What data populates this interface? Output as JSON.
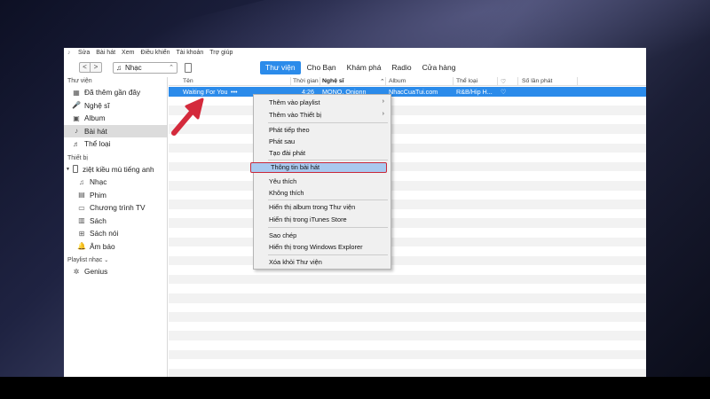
{
  "menubar": {
    "items": [
      "Sửa",
      "Bài hát",
      "Xem",
      "Điều khiển",
      "Tài khoản",
      "Trợ giúp"
    ]
  },
  "toolbar": {
    "back": "<",
    "forward": ">",
    "media_select": "Nhạc",
    "tabs": [
      "Thư viện",
      "Cho Bạn",
      "Khám phá",
      "Radio",
      "Cửa hàng"
    ],
    "active_tab": "Thư viện"
  },
  "sidebar": {
    "library_header": "Thư viện",
    "library_items": [
      {
        "label": "Đã thêm gần đây",
        "icon": "recent-icon"
      },
      {
        "label": "Nghệ sĩ",
        "icon": "artist-icon"
      },
      {
        "label": "Album",
        "icon": "album-icon"
      },
      {
        "label": "Bài hát",
        "icon": "song-icon"
      },
      {
        "label": "Thể loại",
        "icon": "genre-icon"
      }
    ],
    "selected": "Bài hát",
    "devices_header": "Thiết bị",
    "device_name": "ziệt kiều mù tiếng anh",
    "device_items": [
      {
        "label": "Nhạc",
        "icon": "music-icon"
      },
      {
        "label": "Phim",
        "icon": "film-icon"
      },
      {
        "label": "Chương trình TV",
        "icon": "tv-icon"
      },
      {
        "label": "Sách",
        "icon": "book-icon"
      },
      {
        "label": "Sách nói",
        "icon": "audiobook-icon"
      },
      {
        "label": "Âm báo",
        "icon": "bell-icon"
      }
    ],
    "playlists_header": "Playlist nhạc",
    "playlist_items": [
      {
        "label": "Genius",
        "icon": "genius-icon"
      }
    ]
  },
  "list": {
    "columns": {
      "name": "Tên",
      "time": "Thời gian",
      "artist": "Nghệ sĩ",
      "album": "Album",
      "genre": "Thể loại",
      "love": "♡",
      "plays": "Số lần phát"
    },
    "selected_row": {
      "name": "Waiting For You",
      "more": "•••",
      "time": "4:26",
      "artist": "MONO, Onionn",
      "album": "NhacCuaTui.com",
      "genre": "R&B/Hip H...",
      "love": "♡"
    }
  },
  "context_menu": {
    "groups": [
      [
        {
          "label": "Thêm vào playlist",
          "submenu": true
        },
        {
          "label": "Thêm vào Thiết bị",
          "submenu": true
        }
      ],
      [
        {
          "label": "Phát tiếp theo"
        },
        {
          "label": "Phát sau"
        },
        {
          "label": "Tạo đài phát"
        }
      ],
      [
        {
          "label": "Thông tin bài hát",
          "highlighted": true
        },
        {
          "label": "Yêu thích"
        },
        {
          "label": "Không thích"
        }
      ],
      [
        {
          "label": "Hiển thị album trong Thư viện"
        },
        {
          "label": "Hiển thị trong iTunes Store"
        }
      ],
      [
        {
          "label": "Sao chép"
        },
        {
          "label": "Hiển thị trong Windows Explorer"
        }
      ],
      [
        {
          "label": "Xóa khỏi Thư viện"
        }
      ]
    ],
    "submenu_arrow": "›"
  },
  "colors": {
    "accent": "#2b8bea",
    "highlight_border": "#c8283a",
    "highlight_fill": "#a9c9ef",
    "arrow": "#d42a3c"
  }
}
